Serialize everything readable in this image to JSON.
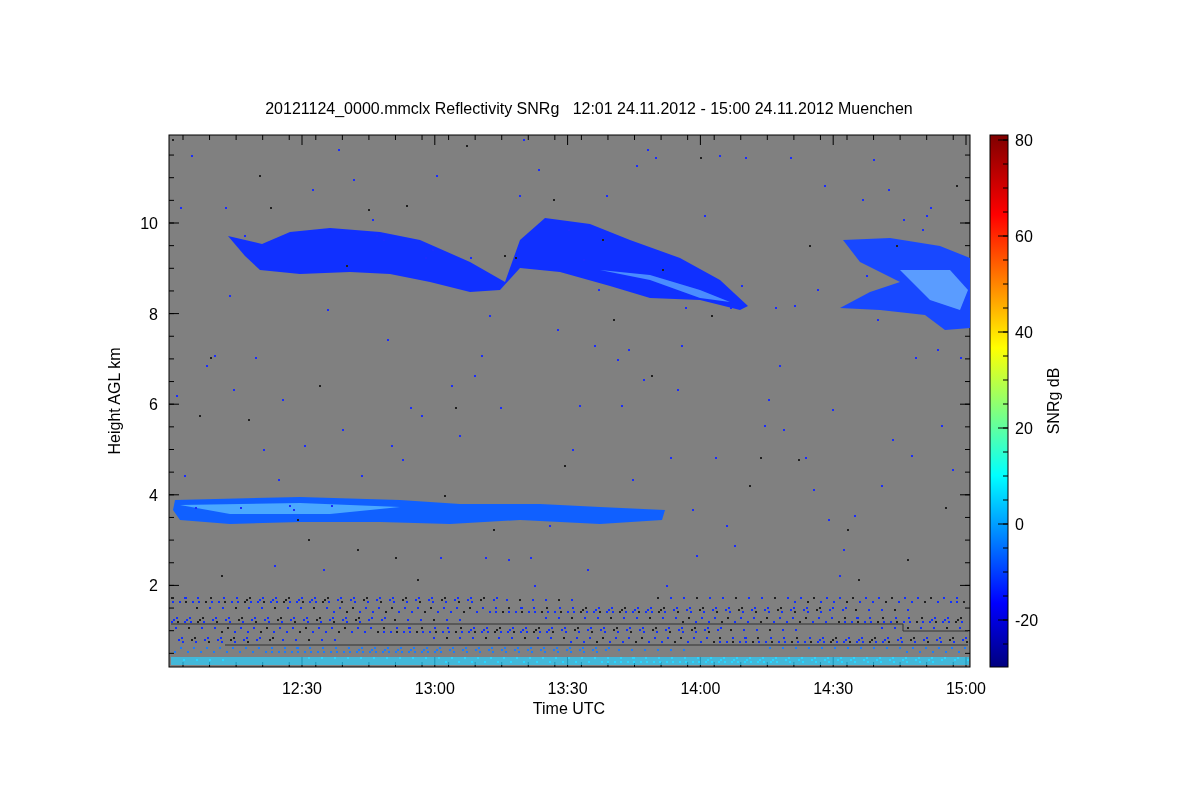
{
  "plot": {
    "title": "20121124_0000.mmclx Reflectivity SNRg   12:01 24.11.2012 - 15:00 24.11.2012 Muenchen",
    "x_axis": {
      "label": "Time UTC",
      "ticks": [
        "12:30",
        "13:00",
        "13:30",
        "14:00",
        "14:30",
        "15:00"
      ]
    },
    "y_axis": {
      "label": "Height AGL km",
      "ticks": [
        "10",
        "8",
        "6",
        "4",
        "2"
      ]
    },
    "colorbar": {
      "label": "SNRg dB",
      "ticks": [
        "80",
        "60",
        "40",
        "20",
        "0",
        "-20"
      ]
    }
  }
}
